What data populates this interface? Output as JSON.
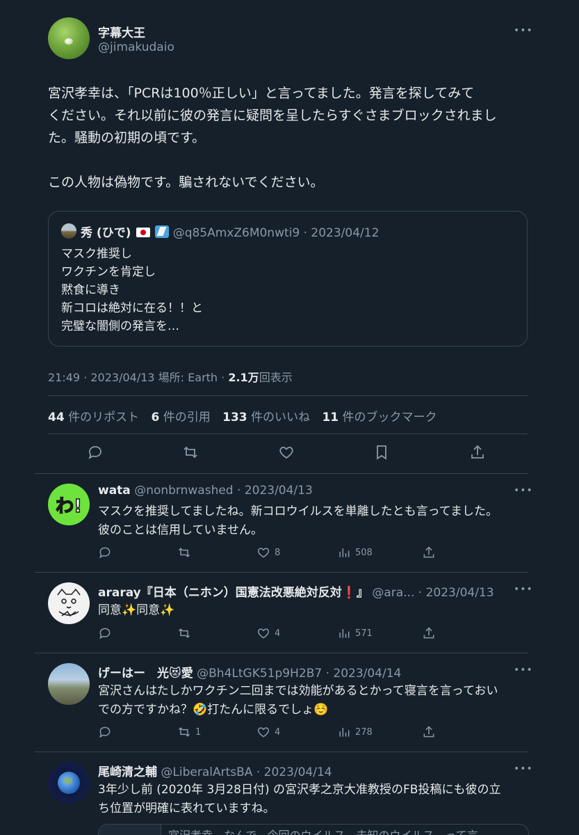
{
  "main_tweet": {
    "display_name": "字幕大王",
    "handle": "@jimakudaio",
    "text": "宮沢孝幸は、「PCRは100％正しい」と言ってました。発言を探してみて\nください。それ以前に彼の発言に疑問を呈したらすぐさまブロックされまし\nた。騒動の初期の頃です。\n\nこの人物は偽物です。騙されないでください。",
    "quote": {
      "name": "秀 (ひで)",
      "handle_date": "@q85AmxZ6M0nwti9 · 2023/04/12",
      "text": "マスク推奨し\nワクチンを肯定し\n黙食に導き\n新コロは絶対に在る！！と\n完璧な闇側の発言を…"
    },
    "meta": {
      "time_date_place": "21:49 · 2023/04/13 場所: Earth · ",
      "views_count": "2.1万",
      "views_label": "回表示"
    },
    "stats": {
      "reposts_count": "44",
      "reposts_label": "件のリポスト",
      "quotes_count": "6",
      "quotes_label": "件の引用",
      "likes_count": "133",
      "likes_label": "件のいいね",
      "bookmarks_count": "11",
      "bookmarks_label": "件のブックマーク"
    }
  },
  "replies": [
    {
      "name": "wata",
      "handle_date": "@nonbrnwashed · 2023/04/13",
      "avatar_text": "わ!",
      "text": "マスクを推奨してましたね。新コロウイルスを単離したとも言ってました。\n彼のことは信用していません。",
      "reply_count": "",
      "repost_count": "",
      "like_count": "8",
      "view_count": "508"
    },
    {
      "name": "araray『日本（ニホン）国憲法改悪絶対反対❗️』",
      "handle_date": "@ara... · 2023/04/13",
      "text": "同意✨同意✨",
      "reply_count": "",
      "repost_count": "",
      "like_count": "4",
      "view_count": "571"
    },
    {
      "name": "げーはー　光😻愛",
      "handle_date": "@Bh4LtGK51p9H2B7 · 2023/04/14",
      "text": "宮沢さんはたしかワクチン二回までは効能があるとかって寝言を言っておい\nでの方ですかね？🤣打たんに限るでしょ☺️",
      "reply_count": "",
      "repost_count": "1",
      "like_count": "4",
      "view_count": "278"
    },
    {
      "name": "尾崎清之輔",
      "handle_date": "@LiberalArtsBA · 2023/04/14",
      "text": "3年少し前 (2020年 3月28日付) の宮沢孝之京大准教授のFB投稿にも彼の立\nち位置が明確に表れていますね。",
      "card_peek_text": "宮沢孝幸　なんで、今回のウイルス、未知のウイルス、って言"
    }
  ],
  "colors": {
    "background": "#15202b",
    "text": "#e7e9ea",
    "muted": "#8b98a5",
    "border": "#38444d"
  },
  "icons": [
    "more-icon",
    "reply-icon",
    "repost-icon",
    "like-icon",
    "bookmark-icon",
    "share-icon",
    "views-icon"
  ]
}
